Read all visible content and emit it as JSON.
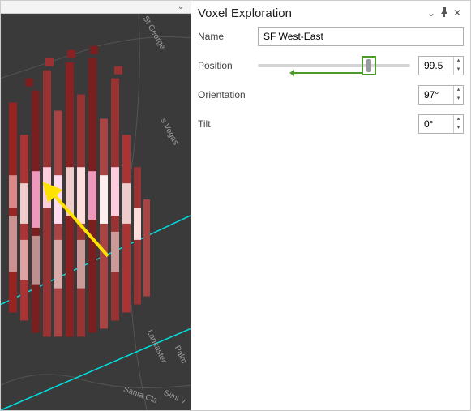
{
  "panel": {
    "title": "Voxel Exploration",
    "name_label": "Name",
    "name_value": "SF West-East",
    "position_label": "Position",
    "position_value": "99.5",
    "position_slider_percent": 73,
    "orientation_label": "Orientation",
    "orientation_value": "97°",
    "tilt_label": "Tilt",
    "tilt_value": "0°"
  },
  "map_labels": {
    "st_george": "St George",
    "s_vegas": "s Vegas",
    "lancaster": "Lancaster",
    "palm": "Palm",
    "santa_cla": "Santa Cla",
    "simi": "Simi V"
  },
  "colors": {
    "highlight": "#4c9a2a",
    "cyan": "#00e0e0",
    "yellow": "#ffe200"
  }
}
